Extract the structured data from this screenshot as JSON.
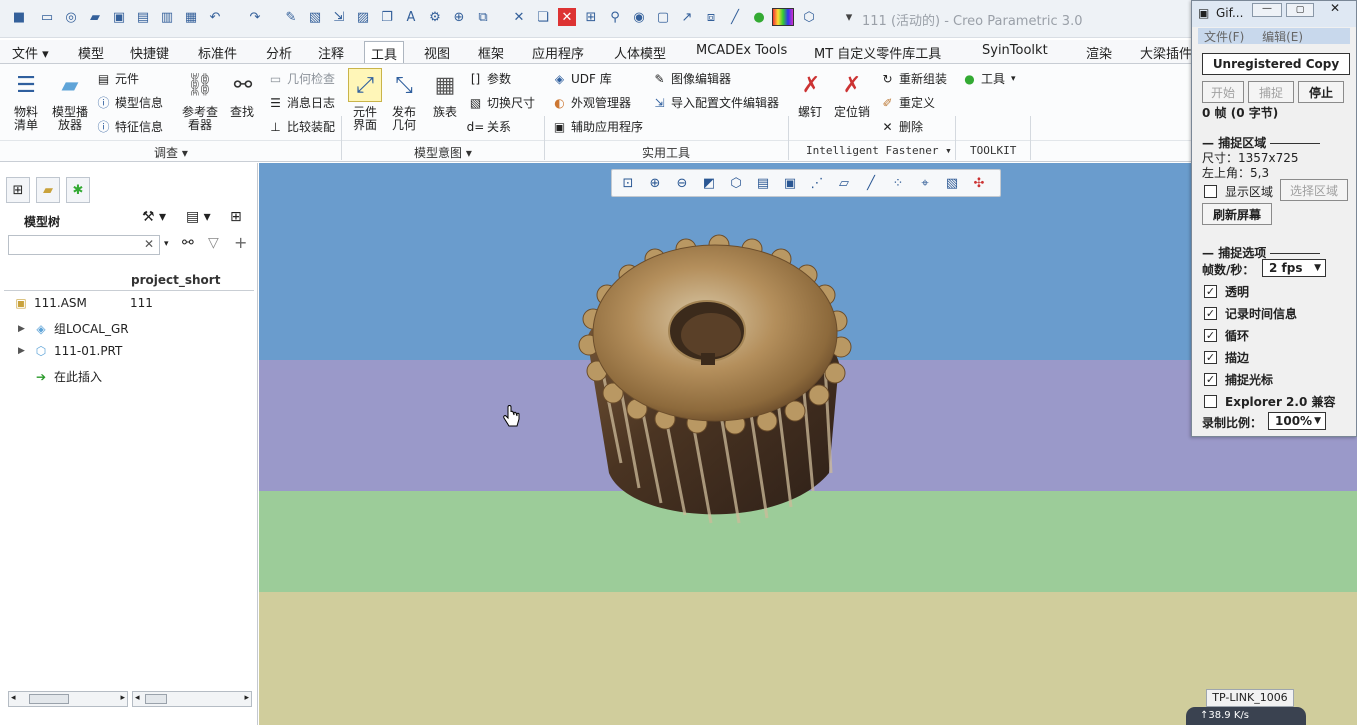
{
  "window": {
    "title": "111 (活动的) - Creo Parametric 3.0",
    "quick_access_icons": [
      "app-icon",
      "new-icon",
      "open-session-icon",
      "open-icon",
      "save-icon",
      "save-as-icon",
      "save-copy-icon",
      "save-backup-icon",
      "undo-icon",
      "redo-icon",
      "regenerate-icon",
      "window-icon",
      "scale-icon",
      "export-icon",
      "text-icon",
      "tool-icon",
      "target-icon",
      "layers-icon",
      "close-window-icon",
      "pen-icon",
      "stop-icon",
      "measure-icon",
      "view-icon",
      "box-icon",
      "paste-icon",
      "ruler-icon",
      "status-icon",
      "color-icon",
      "cube-icon"
    ]
  },
  "menu_tabs": [
    "文件",
    "模型",
    "快捷键",
    "标准件",
    "分析",
    "注释",
    "工具",
    "视图",
    "框架",
    "应用程序",
    "人体模型",
    "MCADEx Tools",
    "MT 自定义零件库工具",
    "SyinToolkt",
    "渲染",
    "大梁插件"
  ],
  "ribbon": {
    "big_buttons": {
      "bom": "物料\n清单",
      "model_player": "模型播\n放器",
      "ref_viewer": "参考查\n看器",
      "find": "查找",
      "component_interface": "元件\n界面",
      "publish_geometry": "发布\n几何",
      "family_table": "族表",
      "screw": "螺钉",
      "locating_pin": "定位销"
    },
    "small_buttons": {
      "component": "元件",
      "model_info": "模型信息",
      "feature_info": "特征信息",
      "geometry_check": "几何检查",
      "message_log": "消息日志",
      "compare_assembly": "比较装配",
      "parameters": "参数",
      "switch_dimensions": "切换尺寸",
      "relations": "关系",
      "udf_library": "UDF 库",
      "appearance_manager": "外观管理器",
      "auxiliary_apps": "辅助应用程序",
      "image_editor": "图像编辑器",
      "import_config_editor": "导入配置文件编辑器",
      "reassemble": "重新组装",
      "redefine": "重定义",
      "delete": "删除",
      "tools": "工具"
    },
    "groups": {
      "investigate": "调查",
      "model_intent": "模型意图",
      "utilities": "实用工具",
      "intelligent_fastener": "Intelligent Fastener",
      "toolkit": "TOOLKIT"
    }
  },
  "left_pane": {
    "title": "模型树",
    "search_value": "",
    "column_header": "project_short",
    "rows": [
      {
        "name": "111.ASM",
        "value": "111"
      },
      {
        "name": "组LOCAL_GR",
        "value": ""
      },
      {
        "name": "111-01.PRT",
        "value": ""
      },
      {
        "name": "在此插入",
        "value": ""
      }
    ]
  },
  "gifcam": {
    "title": "Gif...",
    "menu": [
      "文件(F)",
      "编辑(E)"
    ],
    "banner": "Unregistered Copy",
    "buttons": {
      "start": "开始",
      "capture": "捕捉",
      "stop": "停止"
    },
    "frames": "0 帧 (0 字节)",
    "section_capture_area": "捕捉区域",
    "size": "尺寸：1357x725",
    "top_left": "左上角：5,3",
    "show_region": "显示区域",
    "select_region": "选择区域",
    "refresh_screen": "刷新屏幕",
    "section_capture_options": "捕捉选项",
    "fps_label": "帧数/秒：",
    "fps_value": "2 fps",
    "options": [
      {
        "label": "透明",
        "checked": true
      },
      {
        "label": "记录时间信息",
        "checked": true
      },
      {
        "label": "循环",
        "checked": true
      },
      {
        "label": "描边",
        "checked": true
      },
      {
        "label": "捕捉光标",
        "checked": true
      },
      {
        "label": "Explorer 2.0 兼容",
        "checked": false
      }
    ],
    "scale_label": "录制比例：",
    "scale_value": "100%"
  },
  "tray": {
    "wifi_name": "TP-LINK_1006",
    "net_speed": "38.9 K/s"
  },
  "colors": {
    "sky": "#6a9ccd",
    "band_purple": "#9a99c9",
    "band_green": "#9ccc99",
    "band_tan": "#d0cd9c",
    "accent": "#2f5f9e"
  }
}
